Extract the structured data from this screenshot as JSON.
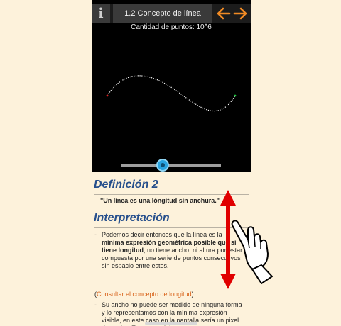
{
  "header": {
    "info_icon": "i",
    "title": "1.2 Concepto de línea",
    "prev_icon": "arrow-left-icon",
    "next_icon": "arrow-right-icon",
    "accent_color": "#f08a24"
  },
  "canvas": {
    "points_label": "Cantidad de puntos: 10^6",
    "curve_color": "#ffffff",
    "start_point_color": "#e02020",
    "end_point_color": "#20c040"
  },
  "slider": {
    "value": 0.4,
    "thumb_color": "#29a3e0"
  },
  "content": {
    "definition_title": "Definición 2",
    "quote": "\"Un línea es una lóngitud sin anchura.\"",
    "interpretation_title": "Interpretación",
    "bullet": "-",
    "p1_a": "Podemos decir entonces que la línea es la ",
    "p1_bold": "mínima expresión geométrica posible que sí tiene longitud",
    "p1_b": ", no tiene ancho, ni altura por estar compuesta por una serie de puntos consecutivos sin espacio entre estos.",
    "link_open": "(",
    "link_text": "Consultar el concepto de longitud",
    "link_close": ").",
    "p2": "Su ancho no puede ser medido de ninguna forma y lo representamos con la mínima expresión visible, en este caso en la pantalla sería un pixel de ancho. En otras palabras",
    "heading_color": "#264f8c",
    "link_color": "#d8641c"
  },
  "overlay": {
    "arrow_color": "#e00000",
    "gesture_icon": "hand-swipe-icon"
  }
}
